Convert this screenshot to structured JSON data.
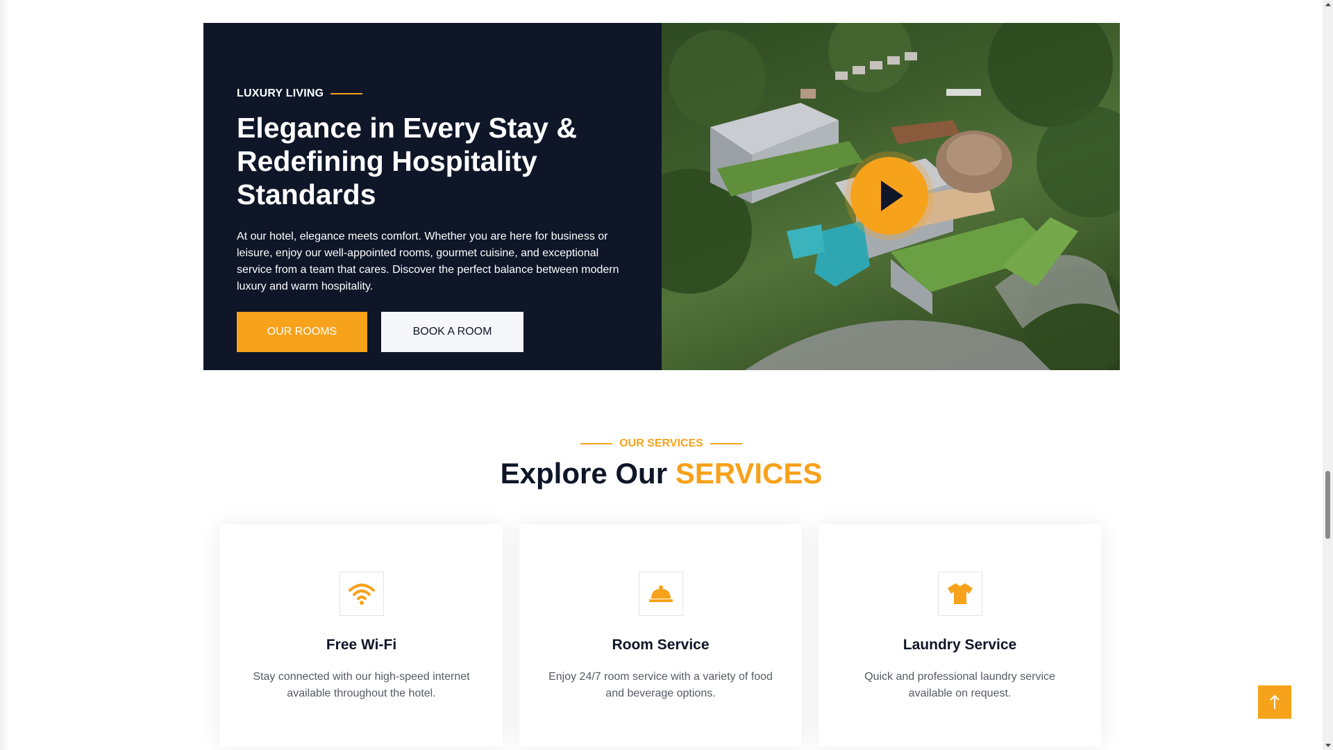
{
  "hero": {
    "eyebrow": "LUXURY LIVING",
    "title": "Elegance in Every Stay & Redefining Hospitality Standards",
    "description": "At our hotel, elegance meets comfort. Whether you are here for business or leisure, enjoy our well-appointed rooms, gourmet cuisine, and exceptional service from a team that cares. Discover the perfect balance between modern luxury and warm hospitality.",
    "primary_button": "OUR ROOMS",
    "secondary_button": "BOOK A ROOM",
    "image_icon": "play-icon"
  },
  "services": {
    "eyebrow": "OUR SERVICES",
    "title_main": "Explore Our ",
    "title_accent": "SERVICES",
    "items": [
      {
        "icon": "wifi-icon",
        "title": "Free Wi-Fi",
        "description": "Stay connected with our high-speed internet available throughout the hotel."
      },
      {
        "icon": "bell-icon",
        "title": "Room Service",
        "description": "Enjoy 24/7 room service with a variety of food and beverage options."
      },
      {
        "icon": "shirt-icon",
        "title": "Laundry Service",
        "description": "Quick and professional laundry service available on request."
      }
    ]
  },
  "back_to_top_icon": "arrow-up-icon",
  "colors": {
    "accent": "#f7a21b",
    "navy": "#0e1628"
  }
}
